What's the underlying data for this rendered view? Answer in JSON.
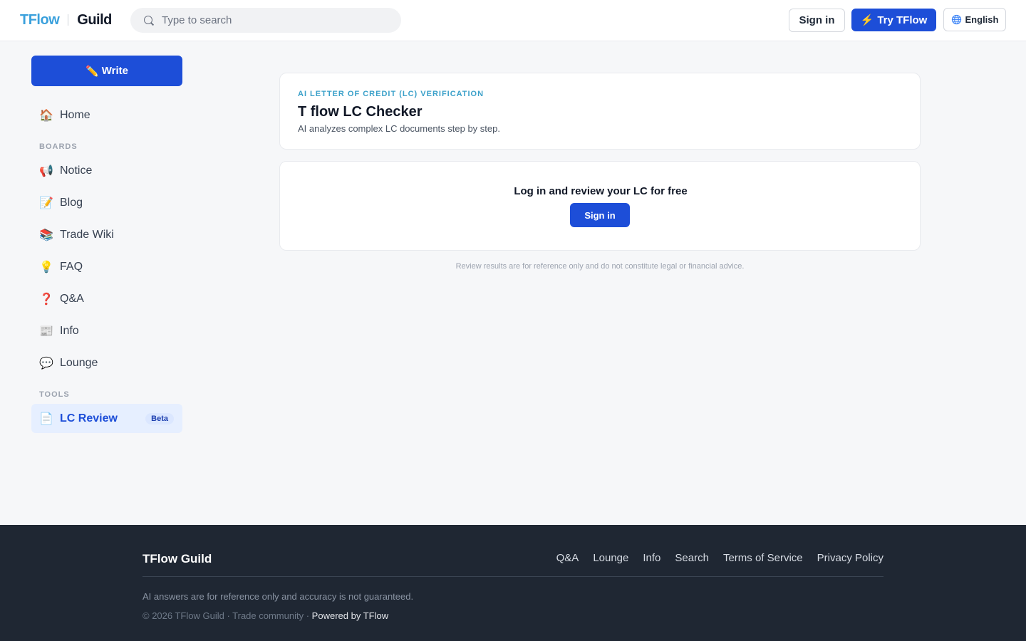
{
  "header": {
    "logo_primary": "TFlow",
    "logo_secondary": "Guild",
    "search_placeholder": "Type to search",
    "sign_in_label": "Sign in",
    "try_label": "Try TFlow",
    "try_icon": "⚡",
    "language_label": "English"
  },
  "sidebar": {
    "write_label": "Write",
    "write_icon": "✏️",
    "home": {
      "icon": "🏠",
      "label": "Home"
    },
    "boards_label": "BOARDS",
    "boards": [
      {
        "icon": "📢",
        "label": "Notice"
      },
      {
        "icon": "📝",
        "label": "Blog"
      },
      {
        "icon": "📚",
        "label": "Trade Wiki"
      },
      {
        "icon": "💡",
        "label": "FAQ"
      },
      {
        "icon": "❓",
        "label": "Q&A"
      },
      {
        "icon": "📰",
        "label": "Info"
      },
      {
        "icon": "💬",
        "label": "Lounge"
      }
    ],
    "tools_label": "TOOLS",
    "tools": [
      {
        "icon": "📄",
        "label": "LC Review",
        "badge": "Beta",
        "active": true
      }
    ]
  },
  "main": {
    "kicker": "AI LETTER OF CREDIT (LC) VERIFICATION",
    "title": "T flow LC Checker",
    "subtitle": "AI analyzes complex LC documents step by step.",
    "cta_text": "Log in and review your LC for free",
    "cta_button": "Sign in",
    "disclaimer": "Review results are for reference only and do not constitute legal or financial advice."
  },
  "footer": {
    "brand": "TFlow Guild",
    "links": [
      "Q&A",
      "Lounge",
      "Info",
      "Search",
      "Terms of Service",
      "Privacy Policy"
    ],
    "note": "AI answers are for reference only and accuracy is not guaranteed.",
    "copyright": "© 2026 TFlow Guild · Trade community ·",
    "powered": "Powered by TFlow"
  },
  "colors": {
    "brand_blue": "#1d4ed8",
    "logo_blue": "#3aa0dc",
    "footer_bg": "#1f2733"
  }
}
